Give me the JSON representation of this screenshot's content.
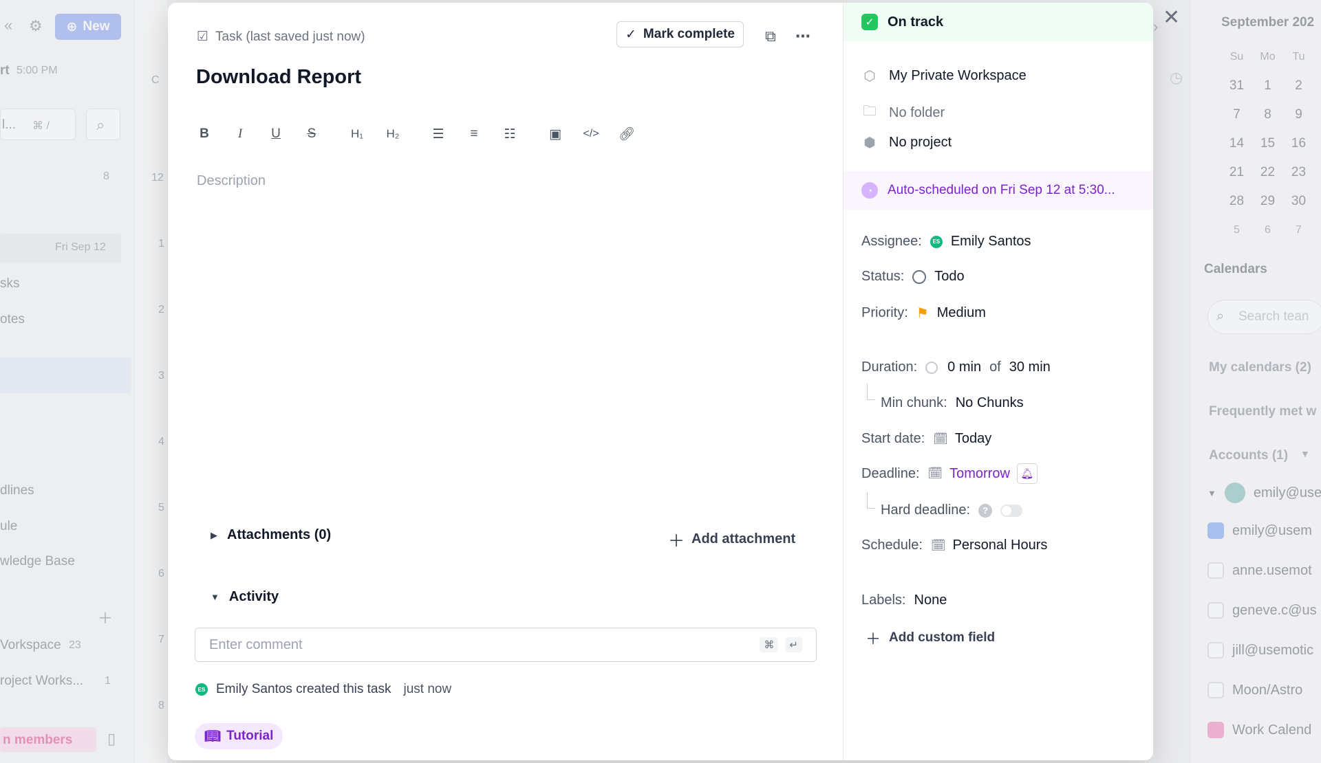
{
  "background": {
    "left": {
      "new_label": "New",
      "time_label": "rt",
      "time_value": "5:00 PM",
      "search_text": "l...",
      "kbd_hint": "⌘ /",
      "count": "8",
      "date": "Fri Sep 12",
      "items": [
        "sks",
        "otes",
        "dlines",
        "ule",
        "wledge Base"
      ],
      "workspace": "Vorkspace",
      "workspace_count": "23",
      "project": "roject Works...",
      "project_count": "1",
      "members": "n members"
    },
    "hours": [
      "12",
      "1",
      "2",
      "3",
      "4",
      "5",
      "6",
      "7",
      "8"
    ],
    "right": {
      "month": "September 202",
      "weekdays": [
        "Su",
        "Mo",
        "Tu"
      ],
      "weeks": [
        [
          "31",
          "1",
          "2"
        ],
        [
          "7",
          "8",
          "9"
        ],
        [
          "14",
          "15",
          "16"
        ],
        [
          "21",
          "22",
          "23"
        ],
        [
          "28",
          "29",
          "30"
        ],
        [
          "5",
          "6",
          "7"
        ]
      ],
      "calendars_title": "Calendars",
      "search_placeholder": "Search tean",
      "my_calendars": "My calendars (2)",
      "frequently_met": "Frequently met w",
      "accounts": "Accounts (1)",
      "emails": [
        "emily@use",
        "emily@usem",
        "anne.usemot",
        "geneve.c@us",
        "jill@usemotic",
        "Moon/Astro",
        "Work Calend"
      ]
    }
  },
  "modal": {
    "task_meta": "Task (last saved just now)",
    "mark_complete": "Mark complete",
    "title": "Download Report",
    "description_placeholder": "Description",
    "attachments_label": "Attachments (0)",
    "add_attachment": "Add attachment",
    "activity_label": "Activity",
    "comment_placeholder": "Enter comment",
    "comment_kbd": [
      "⌘",
      "↵"
    ],
    "activity": {
      "avatar": "ES",
      "text": "Emily Santos created this task",
      "time": "just now"
    },
    "tutorial_label": "Tutorial"
  },
  "side": {
    "status": "On track",
    "workspace": "My Private Workspace",
    "folder": "No folder",
    "project": "No project",
    "auto_scheduled": "Auto-scheduled on Fri Sep 12 at 5:30...",
    "assignee_label": "Assignee:",
    "assignee_avatar": "ES",
    "assignee_value": "Emily Santos",
    "status_label": "Status:",
    "status_value": "Todo",
    "priority_label": "Priority:",
    "priority_value": "Medium",
    "duration_label": "Duration:",
    "duration_done": "0 min",
    "duration_of": "of",
    "duration_total": "30 min",
    "min_chunk_label": "Min chunk:",
    "min_chunk_value": "No Chunks",
    "start_label": "Start date:",
    "start_value": "Today",
    "deadline_label": "Deadline:",
    "deadline_value": "Tomorrow",
    "hard_deadline_label": "Hard deadline:",
    "schedule_label": "Schedule:",
    "schedule_value": "Personal Hours",
    "labels_label": "Labels:",
    "labels_value": "None",
    "add_custom_field": "Add custom field"
  },
  "colors": {
    "accent_purple": "#7e22ce",
    "on_track_green": "#22c55e",
    "priority_orange": "#f59e0b",
    "new_button_blue": "#6f8cf0"
  }
}
